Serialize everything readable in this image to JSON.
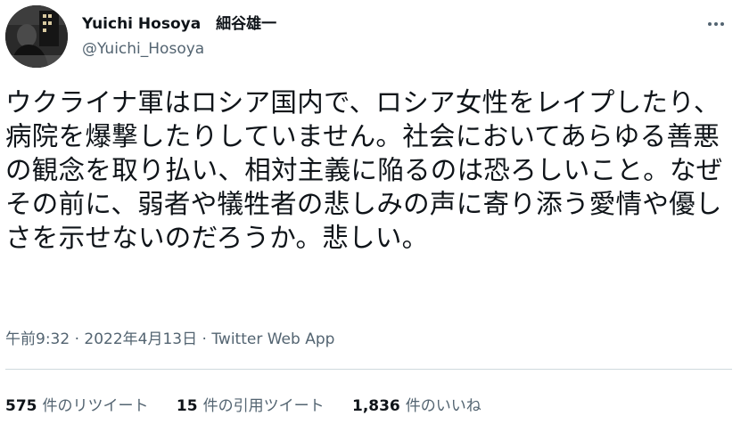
{
  "header": {
    "display_name": "Yuichi Hosoya　細谷雄一",
    "handle": "@Yuichi_Hosoya",
    "avatar_icon": "profile-photo",
    "more_icon": "more-horizontal-icon"
  },
  "tweet": {
    "text": "ウクライナ軍はロシア国内で、ロシア女性をレイプしたり、病院を爆撃したりしていません。社会においてあらゆる善悪の観念を取り払い、相対主義に陥るのは恐ろしいこと。なぜその前に、弱者や犠牲者の悲しみの声に寄り添う愛情や優しさを示せないのだろうか。悲しい。",
    "time": "午前9:32",
    "separator": " · ",
    "date": "2022年4月13日",
    "source": "Twitter Web App"
  },
  "stats": {
    "retweets_count": "575",
    "retweets_label": "件のリツイート",
    "quotes_count": "15",
    "quotes_label": "件の引用ツイート",
    "likes_count": "1,836",
    "likes_label": "件のいいね"
  },
  "colors": {
    "text": "#0f1419",
    "secondary": "#536471",
    "divider": "#cfd9de"
  }
}
